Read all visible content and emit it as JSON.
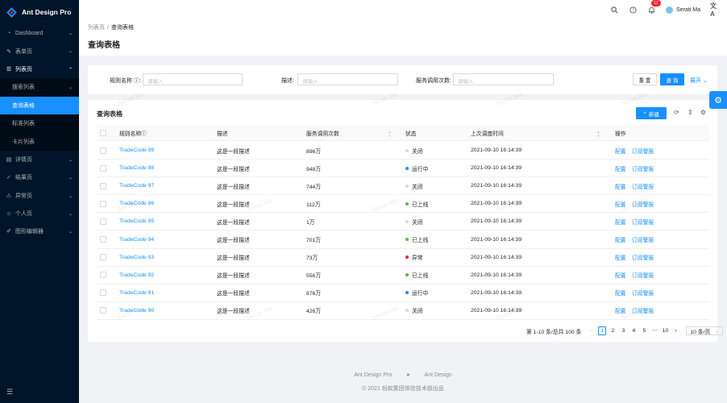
{
  "app": {
    "title": "Ant Design Pro"
  },
  "sidebar": {
    "items": [
      {
        "label": "Dashboard",
        "icon": "dashboard-icon",
        "arrow": "⌄"
      },
      {
        "label": "表单页",
        "icon": "form-icon",
        "arrow": "⌄"
      },
      {
        "label": "列表页",
        "icon": "list-icon",
        "arrow": "⌃",
        "open": true
      },
      {
        "label": "搜索列表",
        "sub": true,
        "arrow": "⌄"
      },
      {
        "label": "查询表格",
        "sub": true,
        "active": true
      },
      {
        "label": "标准列表",
        "sub": true
      },
      {
        "label": "卡片列表",
        "sub": true
      },
      {
        "label": "详情页",
        "icon": "profile-icon",
        "arrow": "⌄"
      },
      {
        "label": "结果页",
        "icon": "check-circle-icon",
        "arrow": "⌄"
      },
      {
        "label": "异常页",
        "icon": "warning-icon",
        "arrow": "⌄"
      },
      {
        "label": "个人页",
        "icon": "user-icon",
        "arrow": "⌄"
      },
      {
        "label": "图形编辑器",
        "icon": "highlight-icon",
        "arrow": "⌄"
      }
    ]
  },
  "header": {
    "notification_count": "11",
    "user_name": "Serati Ma"
  },
  "breadcrumb": {
    "parent": "列表页",
    "separator": "/",
    "current": "查询表格"
  },
  "page": {
    "title": "查询表格"
  },
  "search": {
    "rule_name_label": "规则名称",
    "rule_name_placeholder": "请输入",
    "desc_label": "描述:",
    "desc_placeholder": "请输入",
    "calls_label": "服务调用次数:",
    "calls_placeholder": "请输入",
    "reset": "重 置",
    "query": "查 询",
    "expand": "展开"
  },
  "table": {
    "title": "查询表格",
    "new_button": "新建",
    "columns": {
      "name": "规则名称",
      "desc": "描述",
      "calls": "服务调用次数",
      "status": "状态",
      "updated": "上次调度时间",
      "actions": "操作"
    },
    "action_config": "配置",
    "action_subscribe": "订阅警报",
    "rows": [
      {
        "name": "TradeCode 99",
        "desc": "这是一段描述",
        "calls": "896万",
        "status": "关闭",
        "status_color": "#d9d9d9",
        "updated": "2021-09-10 16:14:39"
      },
      {
        "name": "TradeCode 98",
        "desc": "这是一段描述",
        "calls": "948万",
        "status": "运行中",
        "status_color": "#1890ff",
        "updated": "2021-09-10 16:14:39"
      },
      {
        "name": "TradeCode 97",
        "desc": "这是一段描述",
        "calls": "744万",
        "status": "关闭",
        "status_color": "#d9d9d9",
        "updated": "2021-09-10 16:14:39"
      },
      {
        "name": "TradeCode 96",
        "desc": "这是一段描述",
        "calls": "112万",
        "status": "已上线",
        "status_color": "#52c41a",
        "updated": "2021-09-10 16:14:39"
      },
      {
        "name": "TradeCode 95",
        "desc": "这是一段描述",
        "calls": "1万",
        "status": "关闭",
        "status_color": "#d9d9d9",
        "updated": "2021-09-10 16:14:39"
      },
      {
        "name": "TradeCode 94",
        "desc": "这是一段描述",
        "calls": "701万",
        "status": "已上线",
        "status_color": "#52c41a",
        "updated": "2021-09-10 16:14:39"
      },
      {
        "name": "TradeCode 93",
        "desc": "这是一段描述",
        "calls": "73万",
        "status": "异常",
        "status_color": "#f5222d",
        "updated": "2021-09-10 16:14:39"
      },
      {
        "name": "TradeCode 92",
        "desc": "这是一段描述",
        "calls": "556万",
        "status": "已上线",
        "status_color": "#52c41a",
        "updated": "2021-09-10 16:14:39"
      },
      {
        "name": "TradeCode 91",
        "desc": "这是一段描述",
        "calls": "876万",
        "status": "运行中",
        "status_color": "#1890ff",
        "updated": "2021-09-10 16:14:39"
      },
      {
        "name": "TradeCode 90",
        "desc": "这是一段描述",
        "calls": "426万",
        "status": "关闭",
        "status_color": "#d9d9d9",
        "updated": "2021-09-10 16:14:39"
      }
    ]
  },
  "pagination": {
    "total_text": "第 1-10 条/总共 100 条",
    "pages": [
      "1",
      "2",
      "3",
      "4",
      "5",
      "•••",
      "10"
    ],
    "page_size": "10 条/页"
  },
  "footer": {
    "link1": "Ant Design Pro",
    "link2": "Ant Design",
    "copyright": "© 2021 蚂蚁集团体验技术部出品"
  },
  "watermark": "Serati Ma",
  "colors": {
    "primary": "#1890ff",
    "sider_bg": "#001529"
  }
}
